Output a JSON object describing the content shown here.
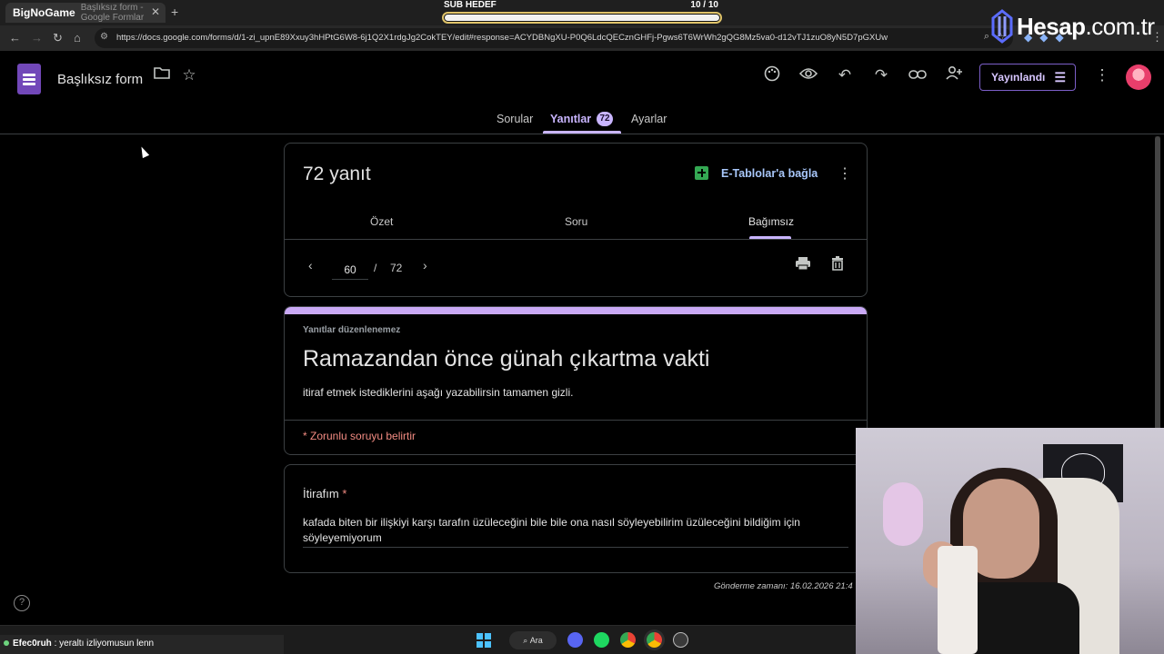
{
  "browser": {
    "tab_title": "Başlıksız form - Google Formlar",
    "tab_brand": "BigNoGame",
    "url": "https://docs.google.com/forms/d/1-zi_upnE89Xxuy3hHPtG6W8-6j1Q2X1rdgJg2CokTEY/edit#response=ACYDBNgXU-P0Q6LdcQECznGHFj-Pgws6T6WrWh2gQG8Mz5va0-d12vTJ1zuO8yN5D7pGXUw"
  },
  "sub_goal": {
    "label": "SUB HEDEF",
    "count_text": "10  / 10",
    "progress_fraction": 1.0
  },
  "watermark": {
    "brand": "Hesap",
    "suffix": ".com.tr"
  },
  "header": {
    "form_name": "Başlıksız form",
    "publish_label": "Yayınlandı"
  },
  "tabs": {
    "questions": "Sorular",
    "responses": "Yanıtlar",
    "responses_count": "72",
    "settings": "Ayarlar"
  },
  "summary": {
    "title": "72 yanıt",
    "sheets_link": "E-Tablolar'a bağla",
    "subtabs": {
      "summary": "Özet",
      "question": "Soru",
      "individual": "Bağımsız"
    },
    "current_page": "60",
    "separator": "/",
    "total_pages": "72"
  },
  "form": {
    "no_edit_notice": "Yanıtlar düzenlenemez",
    "title": "Ramazandan önce günah çıkartma vakti",
    "description": "itiraf etmek istediklerini aşağı yazabilirsin tamamen gizli.",
    "required_notice": "* Zorunlu soruyu belirtir"
  },
  "question": {
    "title": "İtirafım",
    "required_mark": "*",
    "answer": "kafada biten bir ilişkiyi karşı tarafın üzüleceğini bile bile ona nasıl söyleyebilirim üzüleceğini bildiğim için söyleyemiyorum",
    "submitted_at": "Gönderme zamanı: 16.02.2026 21:4"
  },
  "chat": {
    "user": "Efec0ruh",
    "message": ": yeraltı izliyomusun lenn"
  },
  "taskbar": {
    "search_label": "Ara"
  },
  "colors": {
    "accent": "#c9b5ff",
    "forms_purple": "#7248b9",
    "required_red": "#f28b82",
    "sheets_green": "#34a853"
  }
}
